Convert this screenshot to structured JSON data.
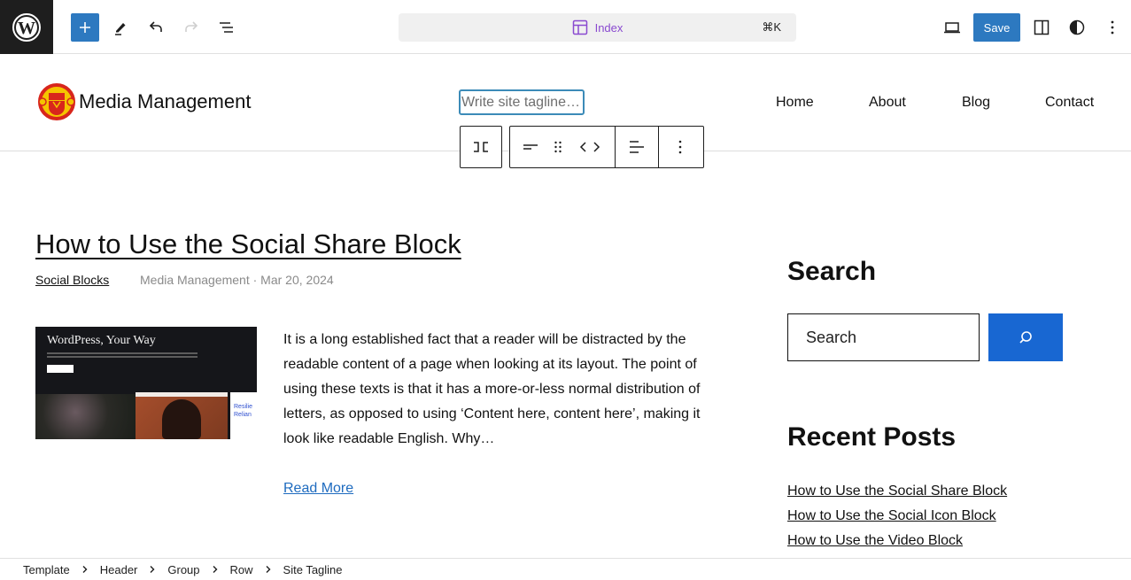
{
  "editor": {
    "document_title": "Index",
    "shortcut": "⌘K",
    "save_label": "Save",
    "icons": [
      "wordpress-logo",
      "plus",
      "pencil",
      "undo",
      "redo",
      "list-view",
      "template",
      "desktop-preview",
      "sidebar-toggle",
      "styles-contrast",
      "more-vertical"
    ]
  },
  "site": {
    "title": "Media Management",
    "tagline_placeholder": "Write site tagline…",
    "nav": [
      "Home",
      "About",
      "Blog",
      "Contact"
    ]
  },
  "block_toolbar": {
    "icons": [
      "transform",
      "align-left",
      "drag-handle",
      "move-arrows",
      "text-align",
      "more-options"
    ]
  },
  "post": {
    "title": "How to Use the Social Share Block",
    "category": "Social Blocks",
    "meta": "Media Management · Mar 20, 2024",
    "thumbnail": {
      "heading": "WordPress, Your Way",
      "side_text": "Resilie Relian"
    },
    "excerpt": "It is a long established fact that a reader will be distracted by the readable content of a page when looking at its layout. The point of using these texts is that it has a more-or-less normal distribution of letters, as opposed to using ‘Content here, content here’, making it look like readable English. Why…",
    "read_more": "Read More"
  },
  "sidebar": {
    "search_heading": "Search",
    "search_placeholder": "Search",
    "recent_heading": "Recent Posts",
    "recent_posts": [
      "How to Use the Social Share Block",
      "How to Use the Social Icon Block",
      "How to Use the Video Block"
    ]
  },
  "breadcrumb": [
    "Template",
    "Header",
    "Group",
    "Row",
    "Site Tagline"
  ],
  "colors": {
    "accent": "#2d79c0",
    "command_title": "#8a4ad0",
    "search_button": "#1867d2",
    "link": "#1e6bbf"
  }
}
